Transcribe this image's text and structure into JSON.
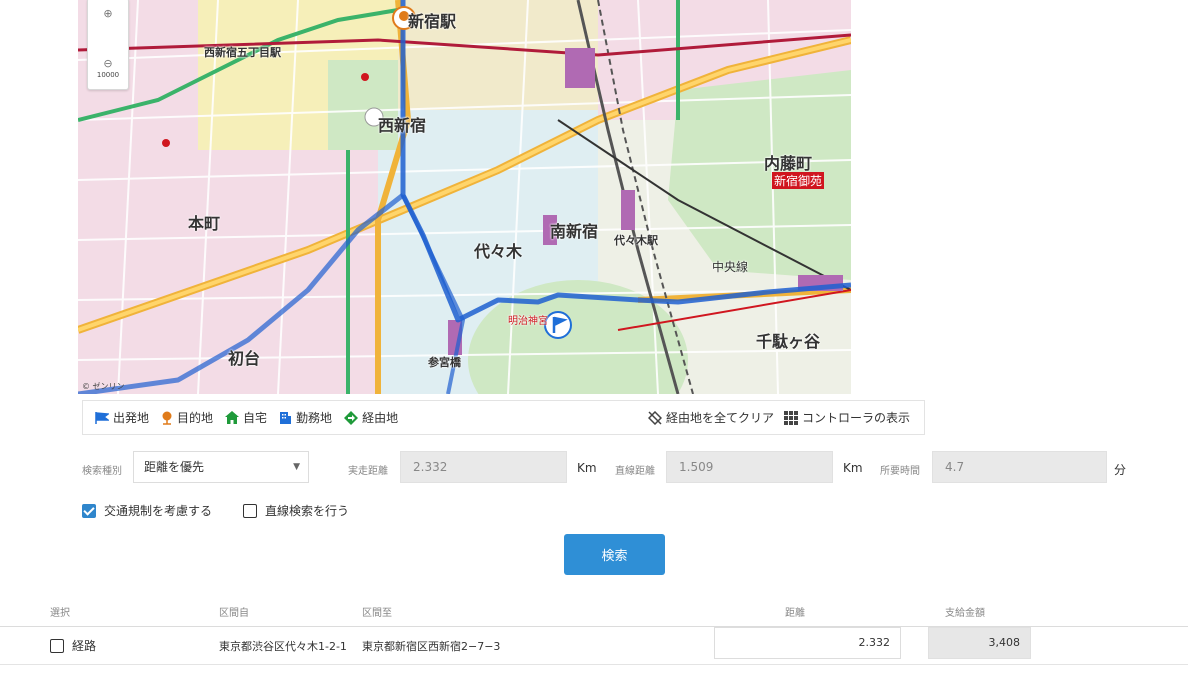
{
  "map": {
    "zoom_in": "⊕",
    "zoom_out": "⊖",
    "scale": "10000",
    "labels": {
      "shinjuku_station": "新宿駅",
      "nishishinjuku": "西新宿",
      "yoyogi": "代々木",
      "minami_shinjuku": "南新宿",
      "naitomachi": "内藤町",
      "shinjuku_gyoen": "新宿御苑",
      "hommachi": "本町",
      "hatsudai": "初台",
      "sendagaya": "千駄ヶ谷",
      "chuo_line": "中央線",
      "meiji_jingu": "明治神宮",
      "nishishinjuku_gochome": "西新宿五丁目駅",
      "sangubashi": "参宮橋",
      "yoyogi_station": "代々木駅"
    },
    "copyright": "© ゼンリン"
  },
  "toolbar": {
    "departure": "出発地",
    "destination": "目的地",
    "home": "自宅",
    "office": "勤務地",
    "waypoint": "経由地",
    "clear_waypoints": "経由地を全てクリア",
    "show_controller": "コントローラの表示"
  },
  "form": {
    "search_type_label": "検索種別",
    "search_type_value": "距離を優先",
    "actual_distance_label": "実走距離",
    "actual_distance_value": "2.332",
    "straight_distance_label": "直線距離",
    "straight_distance_value": "1.509",
    "time_label": "所要時間",
    "time_value": "4.7",
    "unit_km": "Km",
    "unit_min": "分",
    "traffic_rules_label": "交通規制を考慮する",
    "traffic_rules_checked": true,
    "straight_search_label": "直線検索を行う",
    "straight_search_checked": false,
    "search_button": "検索"
  },
  "table": {
    "headers": {
      "select": "選択",
      "from": "区間自",
      "to": "区間至",
      "distance": "距離",
      "payment": "支給金額"
    },
    "rows": [
      {
        "label": "経路",
        "from": "東京都渋谷区代々木1-2-1",
        "to": "東京都新宿区西新宿2−7−3",
        "distance": "2.332",
        "payment": "3,408"
      }
    ]
  },
  "colors": {
    "route": "#1f5fd0",
    "accent": "#2f8fd6",
    "start_flag": "#1f6fd8",
    "goal_pin": "#e07b1a",
    "home": "#1f9a3a",
    "waypoint": "#1f9a3a"
  }
}
